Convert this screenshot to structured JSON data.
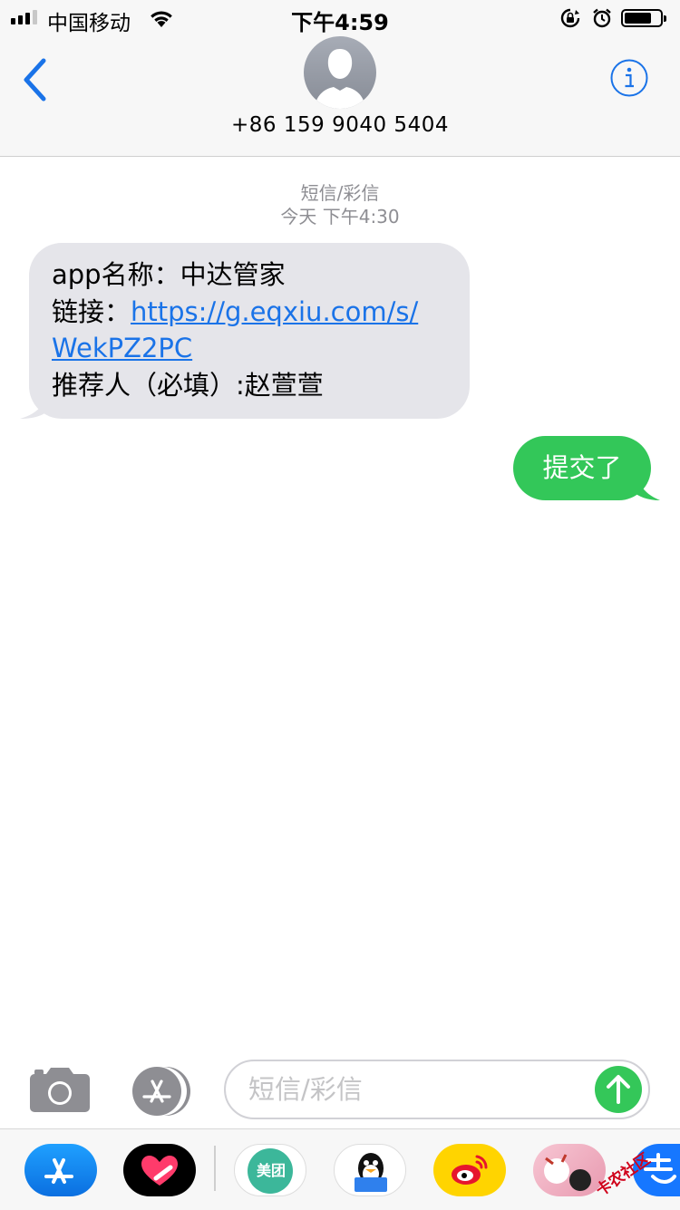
{
  "status_bar": {
    "carrier": "中国移动",
    "time": "下午4:59",
    "battery_level": 0.75
  },
  "header": {
    "contact_number": "+86 159 9040 5404"
  },
  "thread": {
    "service_label": "短信/彩信",
    "timestamp": "今天 下午4:30",
    "incoming": {
      "line1": "app名称：中达管家",
      "line2_prefix": "链接：",
      "link_part1": "https://g.eqxiu.com/s/",
      "link_part2": "WekPZ2PC",
      "line4": "推荐人（必填）:赵萱萱"
    },
    "outgoing": {
      "text": "提交了"
    }
  },
  "composer": {
    "placeholder": "短信/彩信"
  },
  "app_drawer": {
    "meituan_label": "美团"
  },
  "watermark": "卡农社区",
  "colors": {
    "ios_blue": "#1a73e8",
    "incoming_bubble": "#e5e5ea",
    "outgoing_bubble": "#33c759",
    "send_button": "#34c759"
  }
}
